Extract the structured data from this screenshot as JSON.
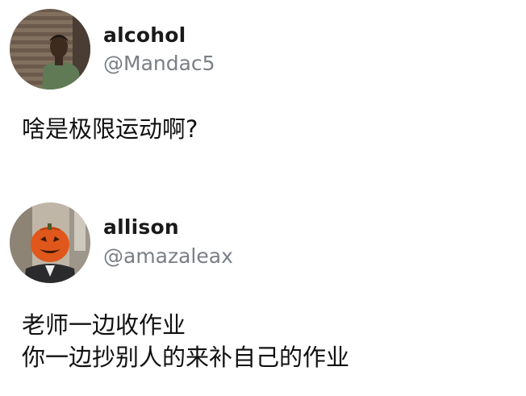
{
  "posts": [
    {
      "display_name": "alcohol",
      "handle": "@Mandac5",
      "avatar_icon": "person-photo-avatar",
      "body_lines": [
        "啥是极限运动啊?"
      ]
    },
    {
      "display_name": "allison",
      "handle": "@amazaleax",
      "avatar_icon": "pumpkin-head-photo-avatar",
      "body_lines": [
        "老师一边收作业",
        "你一边抄别人的来补自己的作业"
      ]
    }
  ]
}
